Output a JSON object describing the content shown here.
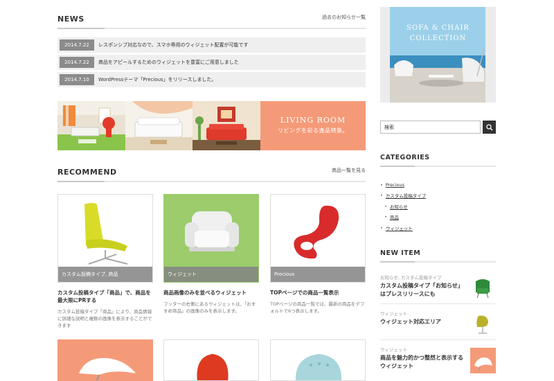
{
  "news": {
    "title": "NEWS",
    "more_link": "過去のお知らせ一覧",
    "items": [
      {
        "date": "2014.7.22",
        "text": "レスポンシブ対応なので、スマホ専用のウィジェット配置が可能です"
      },
      {
        "date": "2014.7.22",
        "text": "商品をアピールするためのウィジェットを豊富にご用意しました"
      },
      {
        "date": "2014.7.10",
        "text": "WordPressテーマ「Precious」をリリースしました。"
      }
    ]
  },
  "banner": {
    "title_en": "LIVING ROOM",
    "title_jp": "リビングを彩る逸品特集。"
  },
  "recommend": {
    "title": "RECOMMEND",
    "more_link": "商品一覧を見る",
    "cards": [
      {
        "tag": "カスタム投稿タイプ, 商品",
        "title": "カスタム投稿タイプ「商品」で、商品を最大限にPRする",
        "desc": "カスタム投稿タイプ「商品」により、商品情報に詳細な説明と複数の画像を表示することができます"
      },
      {
        "tag": "ウィジェット",
        "title": "商品画像のみを並べるウィジェット",
        "desc": "フッターの右側にあるウィジェットは、「おすすめ商品」の画像のみを表示します。"
      },
      {
        "tag": "Precious",
        "title": "TOPページでの商品一覧表示",
        "desc": "TOPページの商品一覧では、最新の商品をデフォルトで6つ表示します。"
      }
    ]
  },
  "sidebar": {
    "promo_line1": "SOFA & CHAIR",
    "promo_line2": "COLLECTION",
    "search_value": "検索",
    "categories_title": "CATEGORIES",
    "categories": [
      {
        "label": "Precious",
        "sub": false
      },
      {
        "label": "カスタム投稿タイプ",
        "sub": false
      },
      {
        "label": "お知らせ",
        "sub": true
      },
      {
        "label": "商品",
        "sub": true
      },
      {
        "label": "ウィジェット",
        "sub": false
      }
    ],
    "newitem_title": "NEW ITEM",
    "new_items": [
      {
        "meta": "お知らせ, カスタム投稿タイプ",
        "title": "カスタム投稿タイプ「お知らせ」はプレスリリースにも"
      },
      {
        "meta": "ウィジェット",
        "title": "ウィジェット対応エリア"
      },
      {
        "meta": "ウィジェット",
        "title": "商品を魅力的かつ整然と表示するウィジェット"
      }
    ]
  },
  "colors": {
    "accent_salmon": "#f59a78",
    "accent_green": "#9ccc6c",
    "dark": "#333333"
  }
}
